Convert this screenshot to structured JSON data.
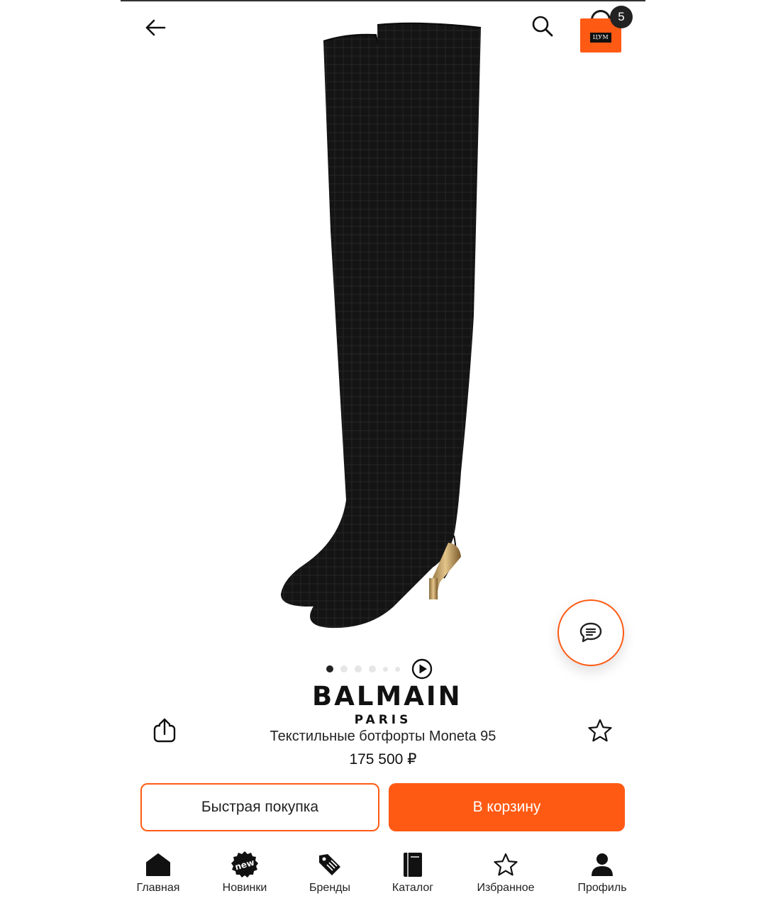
{
  "header": {
    "back_icon": "arrow-left-icon",
    "search_icon": "search-icon",
    "cart": {
      "icon": "shopping-bag-icon",
      "logo_text": "ЦУМ",
      "badge_count": "5",
      "color": "#ff5a14"
    }
  },
  "gallery": {
    "image_alt": "Текстильные ботфорты Moneta 95",
    "dots_total": 6,
    "active_index": 0,
    "video_icon": "play-circle-icon"
  },
  "chat_icon": "chat-bubble-icon",
  "product": {
    "brand_name": "BALMAIN",
    "brand_sub": "PARIS",
    "title": "Текстильные ботфорты Moneta 95",
    "price": "175 500 ₽",
    "share_icon": "share-icon",
    "favorite_icon": "star-outline-icon"
  },
  "actions": {
    "quick_buy_label": "Быстрая покупка",
    "add_to_cart_label": "В корзину",
    "accent": "#ff5a14"
  },
  "tabbar": {
    "items": [
      {
        "label": "Главная",
        "icon": "home-icon"
      },
      {
        "label": "Новинки",
        "icon": "new-badge-icon",
        "badge_text": "new"
      },
      {
        "label": "Бренды",
        "icon": "tag-icon"
      },
      {
        "label": "Каталог",
        "icon": "book-icon"
      },
      {
        "label": "Избранное",
        "icon": "star-outline-icon"
      },
      {
        "label": "Профиль",
        "icon": "user-icon"
      }
    ]
  }
}
